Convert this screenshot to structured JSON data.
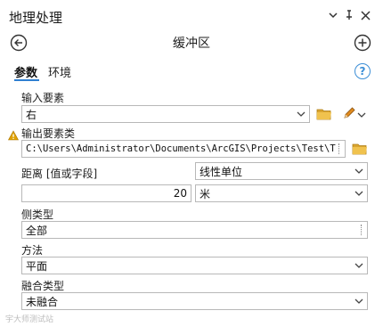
{
  "pane": {
    "title": "地理处理",
    "tool_name": "缓冲区"
  },
  "tabs": [
    {
      "label": "参数",
      "active": true
    },
    {
      "label": "环境",
      "active": false
    }
  ],
  "params": {
    "input_features": {
      "label": "输入要素",
      "value": "右"
    },
    "output_feature_class": {
      "label": "输出要素类",
      "value": "C:\\Users\\Administrator\\Documents\\ArcGIS\\Projects\\Test\\Test."
    },
    "distance": {
      "label": "距离 [值或字段]",
      "value": "20"
    },
    "linear_unit": {
      "label": "线性单位",
      "value": "米"
    },
    "side_type": {
      "label": "侧类型",
      "value": "全部"
    },
    "method": {
      "label": "方法",
      "value": "平面"
    },
    "dissolve_type": {
      "label": "融合类型",
      "value": "未融合"
    }
  },
  "watermark": "宇大师测试站",
  "colors": {
    "accent": "#2f7fd1",
    "folder": "#d9a531",
    "warning": "#e0a100",
    "pencil": "#e08a1e"
  }
}
